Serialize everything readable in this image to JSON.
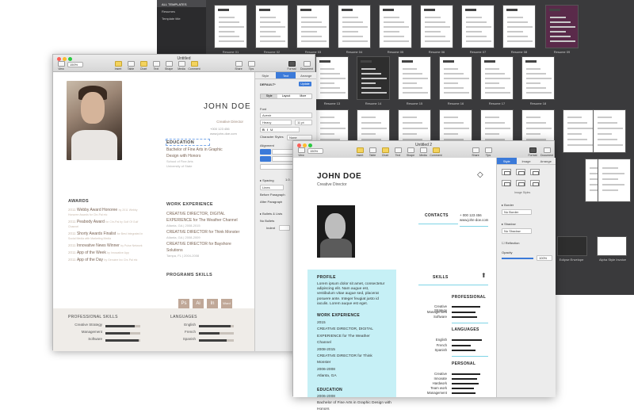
{
  "gallery": {
    "sidebar": [
      "ALL TEMPLATES",
      "Resumes",
      "Template title"
    ],
    "row1_labels": [
      "Resume 01",
      "Resume 02",
      "Resume 03",
      "Resume 04",
      "Resume 05",
      "Resume 06",
      "Resume 07",
      "Resume 08",
      "Resume 09"
    ],
    "row2_labels": [
      "Resume 13",
      "Resume 14",
      "Resume 15",
      "Resume 16",
      "Resume 17",
      "Resume 18"
    ],
    "extra_labels": [
      "Eclipse Envelope",
      "Alpha Style Invoice"
    ]
  },
  "win1": {
    "title": "Untitled",
    "zoom": "150%",
    "toolbar": [
      "View",
      "Zoom",
      "Insert",
      "Table",
      "Chart",
      "Text",
      "Shape",
      "Media",
      "Comment",
      "Share",
      "Tips",
      "Format",
      "Document"
    ],
    "name": "JOHN DOE",
    "role": "Creative Director",
    "phone": "+000 123 456",
    "email": "www.john-doe.com",
    "education_title": "EDUCATION",
    "education_text": [
      "Bachelor of Fine Arts in Graphic",
      "Design with Honors"
    ],
    "education_meta": [
      "School of Fine Arts",
      "University of State"
    ],
    "awards_title": "AWARDS",
    "awards": [
      {
        "year": "2011",
        "title": "Webby Award Honoree",
        "rest": "by 2011 Webby Honoree Awards for Chr-Pal etc"
      },
      {
        "year": "2011",
        "title": "Peabody Award",
        "rest": "for Chr-Pal by Golf Of Gulf Channel"
      },
      {
        "year": "2011",
        "title": "Shorty Awards Finalist",
        "rest": "for Best Integrated in Social Media with Marketing Media"
      },
      {
        "year": "2011",
        "title": "Innovative News Winner",
        "rest": "by Pulse Network"
      },
      {
        "year": "2011",
        "title": "App of the Week",
        "rest": "by Innovative App"
      },
      {
        "year": "2011",
        "title": "App of the Day",
        "rest": "by Genuine Inc Chr-Pal etc"
      }
    ],
    "work_title": "WORK EXPERIENCE",
    "work": [
      {
        "title": "CREATIVE DIRECTOR, DIGITAL EXPERIENCE for The Weather Channel",
        "meta": "Atlanta, GA | 2008-2015"
      },
      {
        "title": "CREATIVE DIRECTOR for Think Monster",
        "meta": "Atlanta, GA | 2008-2009"
      },
      {
        "title": "CREATIVE DIRECTOR for Bayshore Solutions",
        "meta": "Tampa, FL | 2004-2008"
      }
    ],
    "programs_title": "PROGRAMS SKILLS",
    "programs": [
      "Ps",
      "Ai",
      "In",
      "Word"
    ],
    "pro_skills_title": "PROFESSIONAL SKILLS",
    "pro_skills": [
      {
        "label": "Creative Strategy",
        "level": 0.85
      },
      {
        "label": "Management",
        "level": 0.7
      },
      {
        "label": "Software",
        "level": 0.95
      }
    ],
    "languages_title": "LANGUAGES",
    "languages": [
      {
        "label": "English",
        "level": 0.9
      },
      {
        "label": "French",
        "level": 0.6
      },
      {
        "label": "Spanish",
        "level": 0.8
      }
    ],
    "inspector": {
      "tabs": [
        "Style",
        "Text",
        "Arrange"
      ],
      "style_name": "DEFAULT*",
      "update": "Update",
      "subtabs": [
        "Style",
        "Layout",
        "More"
      ],
      "font_label": "Font",
      "font": "Avenir",
      "weight": "Heavy",
      "size": "11 pt",
      "char_styles": "Character Styles",
      "none": "None",
      "alignment": "Alignment",
      "spacing": "Spacing",
      "spacing_val": "1.0 - Single",
      "lines": "Lines",
      "before": "Before Paragraph",
      "after": "After Paragraph",
      "bullets": "Bullets & Lists",
      "bullets_val": "None",
      "no_bullets": "No Bullets",
      "indent": "Indent"
    }
  },
  "win2": {
    "title": "Untitled 2",
    "zoom": "150%",
    "toolbar": [
      "View",
      "Zoom",
      "Insert",
      "Table",
      "Chart",
      "Text",
      "Shape",
      "Media",
      "Comment",
      "Share",
      "Tips",
      "Format",
      "Document"
    ],
    "name": "JOHN DOE",
    "role": "Creative Director",
    "contacts_title": "CONTACTS",
    "phone": "+ 000 123 456",
    "email": "www.john-doe.com",
    "profile_title": "PROFILE",
    "profile_text": [
      "Lorem ipsum dolor sit amet, consectetur",
      "adipiscing elit. Nam augue est,",
      "vestibulum vitae augue sed, placerat",
      "posuere ante. Integer feugiat justo id",
      "iaculis. Lorem auque est eget."
    ],
    "work_title": "WORK EXPERIENCE",
    "work_lines": [
      "2015",
      "CREATIVE DIRECTOR, DIGITAL",
      "EXPERIENCE for The Weather",
      "Channel",
      "2008-2015",
      "CREATIVE DIRECTOR for Think",
      "Monster",
      "2006-2008",
      "Atlanta, GA"
    ],
    "education_title": "EDUCATION",
    "education_lines": [
      "2006-2008",
      "Bachelor of Fine Arts in Graphic Design with",
      "Honors"
    ],
    "skills_title": "SKILLS",
    "professional_title": "PROFESSIONAL",
    "professional": [
      {
        "label": "Creative Strategy",
        "level": 0.9
      },
      {
        "label": "Management",
        "level": 0.75
      },
      {
        "label": "Software",
        "level": 0.8
      }
    ],
    "languages_title": "LANGUAGES",
    "languages": [
      {
        "label": "English",
        "level": 0.95
      },
      {
        "label": "French",
        "level": 0.6
      },
      {
        "label": "Spanish",
        "level": 0.75
      }
    ],
    "personal_title": "PERSONAL",
    "personal": [
      {
        "label": "Creative",
        "level": 0.9
      },
      {
        "label": "Innovate",
        "level": 0.8
      },
      {
        "label": "Hardwork",
        "level": 0.85
      },
      {
        "label": "Team work",
        "level": 0.7
      },
      {
        "label": "Management",
        "level": 0.75
      }
    ],
    "inspector": {
      "tabs": [
        "Style",
        "Image",
        "Arrange"
      ],
      "image_styles": "Image Styles",
      "border": "Border",
      "border_val": "No Border",
      "shadow": "Shadow",
      "shadow_val": "No Shadow",
      "reflection": "Reflection",
      "opacity": "Opacity",
      "opacity_val": "100%"
    }
  }
}
